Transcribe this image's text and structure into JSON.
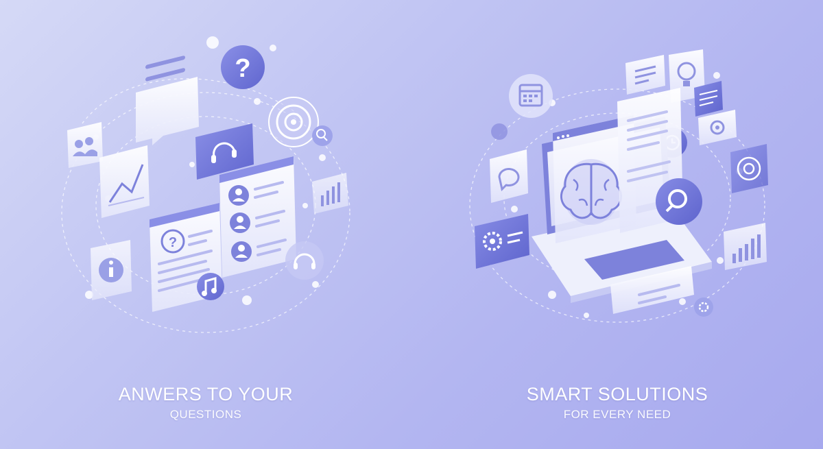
{
  "colors": {
    "background_start": "#d5d9f6",
    "background_end": "#a7a9ee",
    "accent": "#7479d8",
    "accent_dark": "#5c61c7",
    "card_white": "#f4f5fd",
    "caption_text": "#ffffff"
  },
  "left_panel": {
    "heading": "ANWERS TO YOUR",
    "subheading": "QUESTIONS",
    "icons": [
      "question-icon",
      "chat-bubble-icon",
      "group-icon",
      "line-chart-icon",
      "target-icon",
      "headset-icon",
      "user-icon",
      "music-note-icon",
      "info-icon",
      "bar-chart-icon",
      "search-icon"
    ]
  },
  "right_panel": {
    "heading": "SMART SOLUTIONS",
    "subheading": "FOR EVERY NEED",
    "icons": [
      "brain-icon",
      "laptop-icon",
      "calendar-icon",
      "lightbulb-icon",
      "search-icon",
      "gear-icon",
      "bar-chart-icon",
      "clock-icon",
      "target-icon",
      "chat-bubble-icon",
      "document-icon"
    ]
  }
}
